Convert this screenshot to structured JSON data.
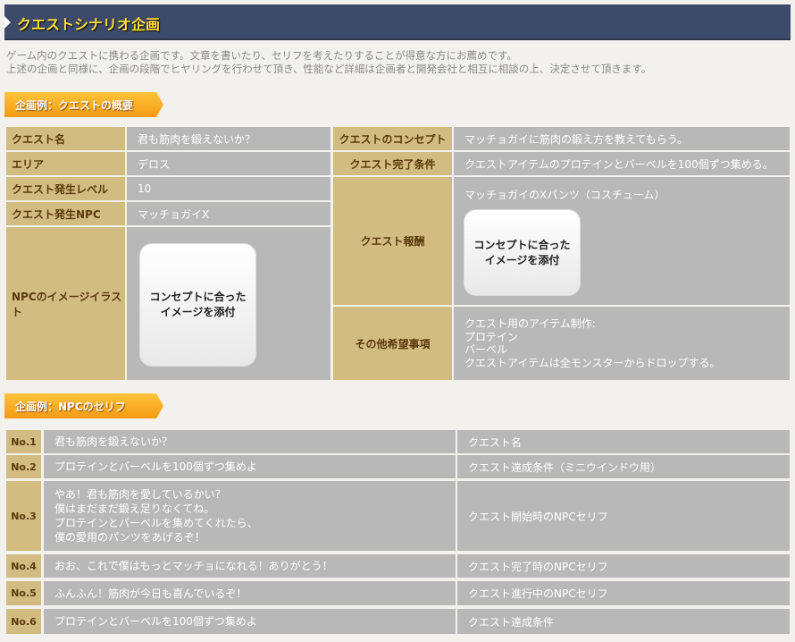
{
  "title": "クエストシナリオ企画",
  "description": [
    "ゲーム内のクエストに携わる企画です。文章を書いたり、セリフを考えたりすることが得意な方にお薦めです。",
    "上述の企画と同様に、企画の段階でヒヤリングを行わせて頂き、性能など詳細は企画者と開発会社と相互に相談の上、決定させて頂きます。"
  ],
  "section1": {
    "heading": "企画例：クエストの概要",
    "quest_name_label": "クエスト名",
    "quest_name": "君も筋肉を鍛えないか？",
    "area_label": "エリア",
    "area": "デロス",
    "level_label": "クエスト発生レベル",
    "level": "10",
    "npc_label": "クエスト発生NPC",
    "npc": "マッチョガイX",
    "illust_label": "NPCのイメージイラスト",
    "illust_placeholder": [
      "コンセプトに合った",
      "イメージを添付"
    ],
    "concept_label": "クエストのコンセプト",
    "concept": "マッチョガイに筋肉の鍛え方を教えてもらう。",
    "complete_label": "クエスト完了条件",
    "complete": "クエストアイテムのプロテインとバーベルを100個ずつ集める。",
    "reward_label": "クエスト報酬",
    "reward": "マッチョガイのXパンツ（コスチューム）",
    "reward_placeholder": [
      "コンセプトに合った",
      "イメージを添付"
    ],
    "other_label": "その他希望事項",
    "other": [
      "クエスト用のアイテム制作:",
      "プロテイン",
      "バーベル",
      "クエストアイテムは全モンスターからドロップする。"
    ]
  },
  "section2": {
    "heading": "企画例：NPCのセリフ",
    "rows": [
      {
        "no": "No.1",
        "lines": [
          "君も筋肉を鍛えないか？"
        ],
        "desc": "クエスト名"
      },
      {
        "no": "No.2",
        "lines": [
          "プロテインとバーベルを100個ずつ集めよ"
        ],
        "desc": "クエスト達成条件（ミニウインドウ用）"
      },
      {
        "no": "No.3",
        "lines": [
          "やあ！君も筋肉を愛しているかい？",
          "僕はまだまだ鍛え足りなくてね。",
          "プロテインとバーベルを集めてくれたら、",
          "僕の愛用のパンツをあげるぞ！"
        ],
        "desc": "クエスト開始時のNPCセリフ"
      },
      {
        "no": "No.4",
        "lines": [
          "おお、これで僕はもっとマッチョになれる！ありがとう！"
        ],
        "desc": "クエスト完了時のNPCセリフ"
      },
      {
        "no": "No.5",
        "lines": [
          "ふんふん！筋肉が今日も喜んでいるぞ！"
        ],
        "desc": "クエスト進行中のNPCセリフ"
      },
      {
        "no": "No.6",
        "lines": [
          "プロテインとバーベルを100個ずつ集めよ"
        ],
        "desc": "クエスト達成条件"
      }
    ]
  }
}
